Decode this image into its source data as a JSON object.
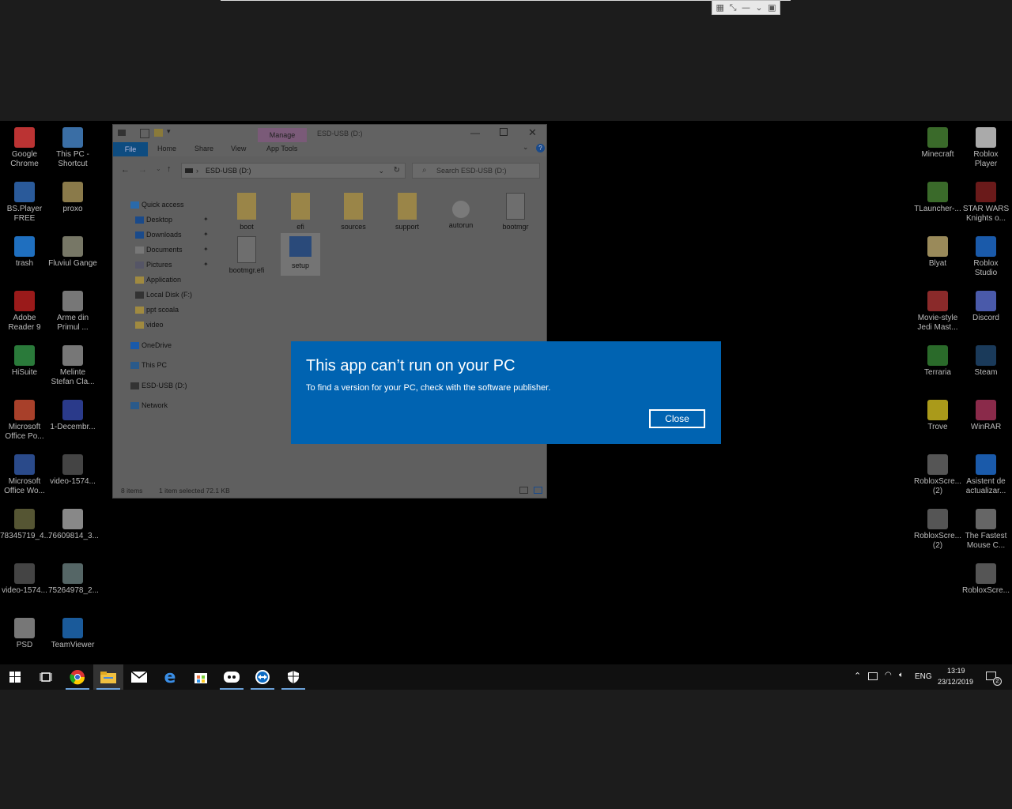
{
  "desktop_left": [
    {
      "label": "Google Chrome",
      "color": "#b33"
    },
    {
      "label": "This PC - Shortcut",
      "color": "#3a6ea5"
    },
    {
      "label": "BS.Player FREE",
      "color": "#2a5a9a"
    },
    {
      "label": "proxo",
      "color": "#8a7a4a"
    },
    {
      "label": "trash",
      "color": "#1f6fbf"
    },
    {
      "label": "Fluviul Gange",
      "color": "#776"
    },
    {
      "label": "Adobe Reader 9",
      "color": "#9a1a1a"
    },
    {
      "label": "Arme din Primul ...",
      "color": "#777"
    },
    {
      "label": "HiSuite",
      "color": "#2a7a3a"
    },
    {
      "label": "Melinte Stefan Cla...",
      "color": "#777"
    },
    {
      "label": "Microsoft Office Po...",
      "color": "#a8402a"
    },
    {
      "label": "1-Decembr...",
      "color": "#2a3a8a"
    },
    {
      "label": "Microsoft Office Wo...",
      "color": "#2a4a8a"
    },
    {
      "label": "video-1574...",
      "color": "#444"
    },
    {
      "label": "78345719_4...",
      "color": "#553"
    },
    {
      "label": "76609814_3...",
      "color": "#888"
    },
    {
      "label": "video-1574...",
      "color": "#444"
    },
    {
      "label": "75264978_2...",
      "color": "#566"
    },
    {
      "label": "PSD",
      "color": "#777"
    },
    {
      "label": "TeamViewer",
      "color": "#1a5a9a"
    }
  ],
  "desktop_right": [
    {
      "label": "Minecraft",
      "color": "#3a6a2a"
    },
    {
      "label": "Roblox Player",
      "color": "#aaa"
    },
    {
      "label": "TLauncher-...",
      "color": "#3a6a2a"
    },
    {
      "label": "STAR WARS Knights o...",
      "color": "#6a1a1a"
    },
    {
      "label": "Blyat",
      "color": "#9a8a5a"
    },
    {
      "label": "Roblox Studio",
      "color": "#1a5aaa"
    },
    {
      "label": "Movie-style Jedi Mast...",
      "color": "#8a2a2a"
    },
    {
      "label": "Discord",
      "color": "#4a5aaa"
    },
    {
      "label": "Terraria",
      "color": "#2a6a2a"
    },
    {
      "label": "Steam",
      "color": "#1a3a5a"
    },
    {
      "label": "Trove",
      "color": "#aa9a1a"
    },
    {
      "label": "WinRAR",
      "color": "#8a2a4a"
    },
    {
      "label": "RobloxScre... (2)",
      "color": "#555"
    },
    {
      "label": "Asistent de actualizar...",
      "color": "#1a5aaa"
    },
    {
      "label": "RobloxScre... (2)",
      "color": "#555"
    },
    {
      "label": "The Fastest Mouse C...",
      "color": "#666"
    },
    {
      "label": "RobloxScre...",
      "color": "#555"
    }
  ],
  "explorer": {
    "title": "ESD-USB (D:)",
    "manage_tab": "Manage",
    "tabs": {
      "file": "File",
      "home": "Home",
      "share": "Share",
      "view": "View",
      "app_tools": "App Tools"
    },
    "address": "ESD-USB (D:)",
    "search_placeholder": "Search ESD-USB (D:)",
    "nav": [
      {
        "label": "Quick access",
        "icon": "star-icon",
        "color": "#2a6aaa"
      },
      {
        "label": "Desktop",
        "icon": "desktop-icon",
        "color": "#1a4a8a"
      },
      {
        "label": "Downloads",
        "icon": "download-icon",
        "color": "#1a4a8a"
      },
      {
        "label": "Documents",
        "icon": "document-icon",
        "color": "#777"
      },
      {
        "label": "Pictures",
        "icon": "pictures-icon",
        "color": "#556"
      },
      {
        "label": "Application",
        "icon": "folder-icon",
        "color": "#a08a40"
      },
      {
        "label": "Local Disk (F:)",
        "icon": "drive-icon",
        "color": "#333"
      },
      {
        "label": "ppt scoala",
        "icon": "folder-icon",
        "color": "#a08a40"
      },
      {
        "label": "video",
        "icon": "folder-icon",
        "color": "#a08a40"
      },
      {
        "label": "OneDrive",
        "icon": "cloud-icon",
        "color": "#1a5aaa"
      },
      {
        "label": "This PC",
        "icon": "pc-icon",
        "color": "#2a5a8a"
      },
      {
        "label": "ESD-USB (D:)",
        "icon": "usb-drive-icon",
        "color": "#333"
      },
      {
        "label": "Network",
        "icon": "network-icon",
        "color": "#2a5a8a"
      }
    ],
    "files": [
      {
        "label": "boot",
        "kind": "folder"
      },
      {
        "label": "efi",
        "kind": "folder"
      },
      {
        "label": "sources",
        "kind": "folder"
      },
      {
        "label": "support",
        "kind": "folder"
      },
      {
        "label": "autorun",
        "kind": "settings"
      },
      {
        "label": "bootmgr",
        "kind": "file"
      },
      {
        "label": "bootmgr.efi",
        "kind": "file"
      },
      {
        "label": "setup",
        "kind": "setup"
      }
    ],
    "status": {
      "items": "8 items",
      "selected": "1 item selected  72.1 KB"
    }
  },
  "dialog": {
    "title": "This app can’t run on your PC",
    "message": "To find a version for your PC, check with the software publisher.",
    "close_label": "Close"
  },
  "taskbar": {
    "language": "ENG",
    "time": "13:19",
    "date": "23/12/2019",
    "notifications": "2"
  }
}
